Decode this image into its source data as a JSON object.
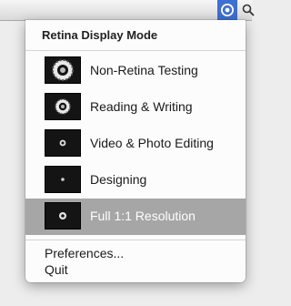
{
  "menubar": {
    "status_icon": "retina-display-icon",
    "next_icon": "spotlight-icon"
  },
  "menu": {
    "title": "Retina Display Mode",
    "modes": [
      {
        "label": "Non-Retina Testing",
        "icon": "aperture-large-icon",
        "selected": false
      },
      {
        "label": "Reading & Writing",
        "icon": "aperture-medium-icon",
        "selected": false
      },
      {
        "label": "Video & Photo Editing",
        "icon": "aperture-small-icon",
        "selected": false
      },
      {
        "label": "Designing",
        "icon": "aperture-tiny-icon",
        "selected": false
      },
      {
        "label": "Full 1:1 Resolution",
        "icon": "aperture-small-icon",
        "selected": true
      }
    ],
    "preferences_label": "Preferences...",
    "quit_label": "Quit"
  },
  "colors": {
    "menubar_highlight": "#3f6fd0",
    "selected_row": "#a6a6a6",
    "thumbnail_bg": "#141414"
  }
}
